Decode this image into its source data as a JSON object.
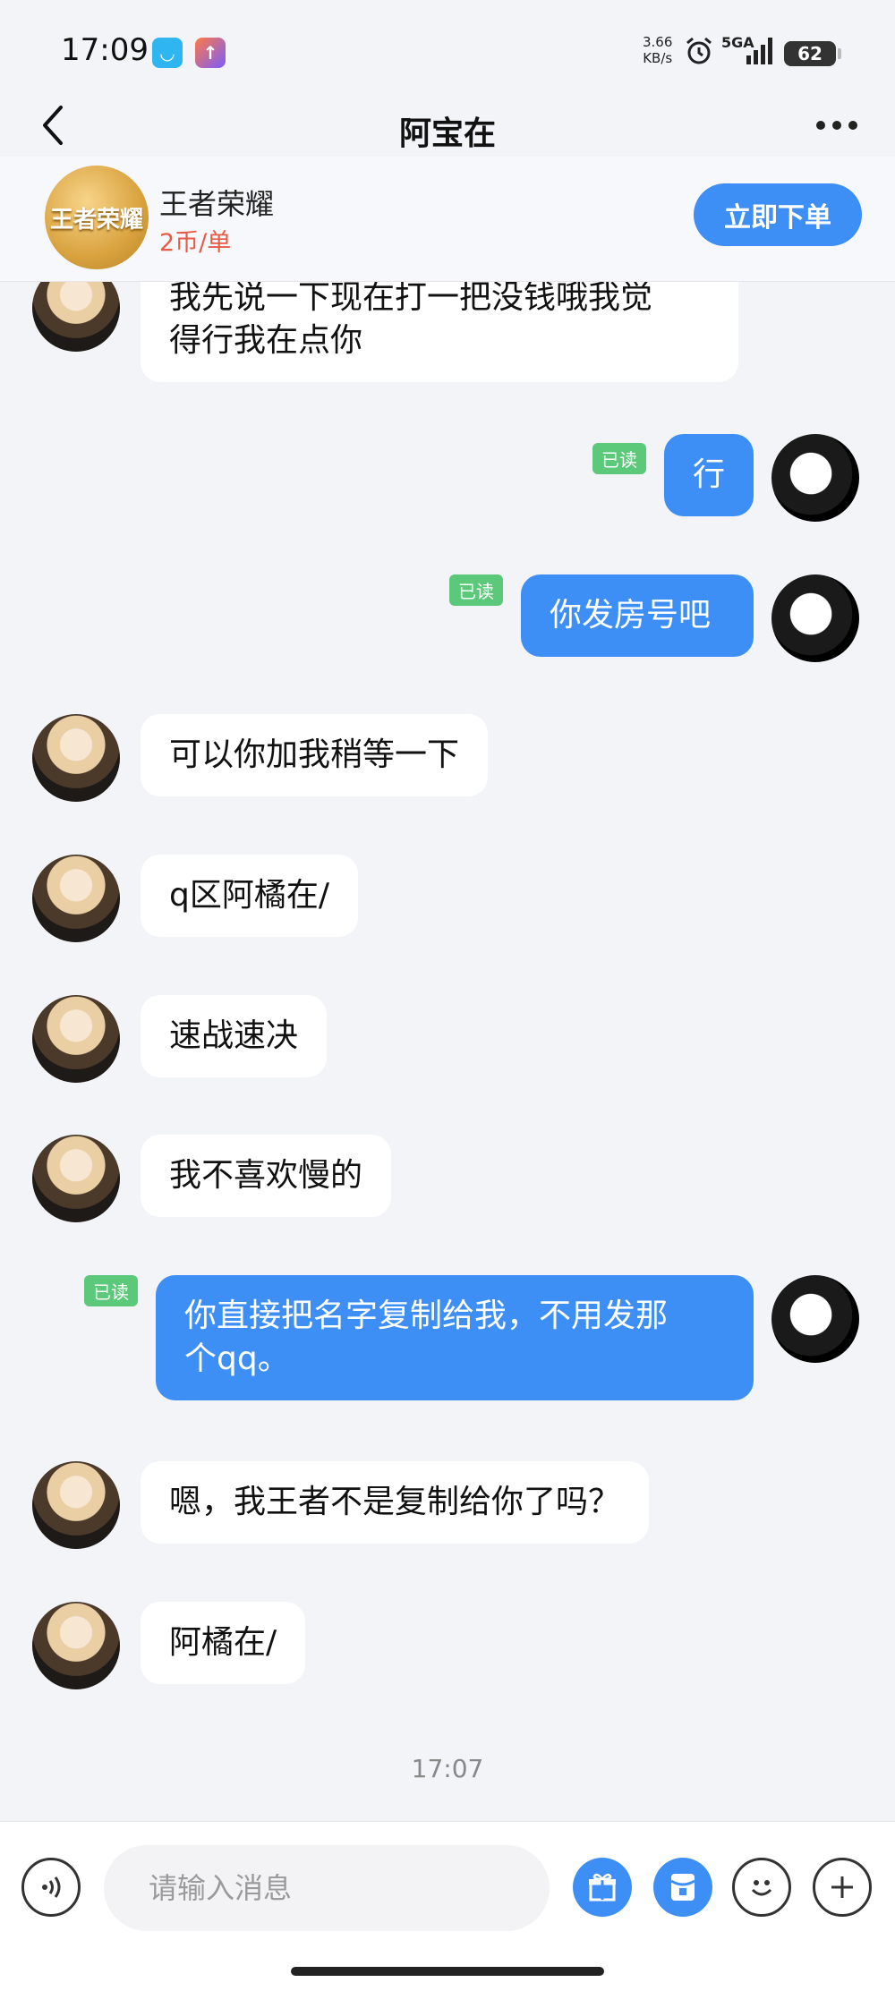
{
  "status_bar": {
    "time": "17:09",
    "net_speed_value": "3.66",
    "net_speed_unit": "KB/s",
    "network": "5GA",
    "battery": "62"
  },
  "nav": {
    "title": "阿宝在"
  },
  "product": {
    "logo_text": "王者荣耀",
    "name": "王者荣耀",
    "price": "2币/单",
    "order_button": "立即下单"
  },
  "messages": [
    {
      "from": "her",
      "text_line1": "我先说一下现在打一把没钱哦我觉",
      "text_line2": "得行我在点你"
    },
    {
      "from": "me",
      "text": "行",
      "read": "已读"
    },
    {
      "from": "me",
      "text": "你发房号吧",
      "read": "已读"
    },
    {
      "from": "her",
      "text": "可以你加我稍等一下"
    },
    {
      "from": "her",
      "text": "q区阿橘在/"
    },
    {
      "from": "her",
      "text": "速战速决"
    },
    {
      "from": "her",
      "text": "我不喜欢慢的"
    },
    {
      "from": "me",
      "text_line1": "你直接把名字复制给我，不用发那",
      "text_line2": "个qq。",
      "read": "已读"
    },
    {
      "from": "her",
      "text": "嗯，我王者不是复制给你了吗？"
    },
    {
      "from": "her",
      "text": "阿橘在/"
    }
  ],
  "timestamp": "17:07",
  "input": {
    "placeholder": "请输入消息"
  },
  "icons": {
    "back": "chevron-left-icon",
    "more": "more-dots-icon",
    "voice": "voice-icon",
    "gift": "gift-icon",
    "redpacket": "red-packet-icon",
    "emoji": "emoji-icon",
    "plus": "plus-icon"
  },
  "colors": {
    "accent": "#3d8ff5",
    "read_tag": "#5cc87a",
    "price": "#e55b4a",
    "background": "#f3f4f8"
  }
}
